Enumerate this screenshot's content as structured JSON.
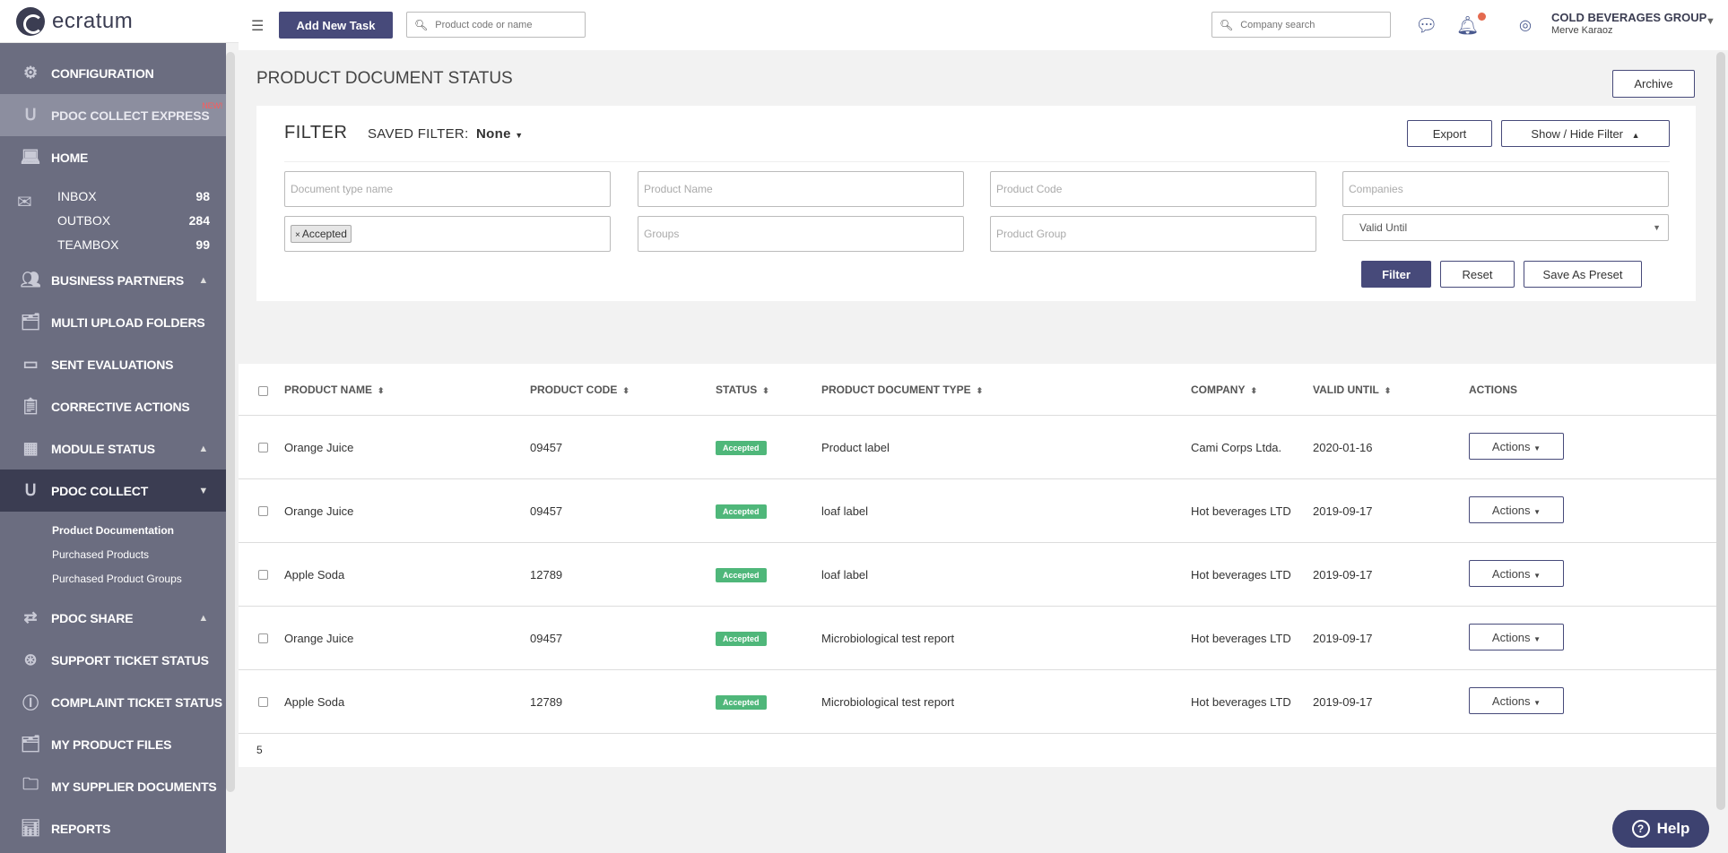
{
  "brand": {
    "logo_text": "ecratum"
  },
  "topbar": {
    "add_task_label": "Add New Task",
    "product_search_placeholder": "Product code or name",
    "company_search_placeholder": "Company search",
    "org_name": "COLD BEVERAGES GROUP",
    "user_name": "Merve Karaoz"
  },
  "sidebar": {
    "configuration": "CONFIGURATION",
    "pdoc_express": "PDOC COLLECT EXPRESS",
    "new_badge": "NEW!",
    "home": "HOME",
    "inbox": {
      "label": "INBOX",
      "count": "98"
    },
    "outbox": {
      "label": "OUTBOX",
      "count": "284"
    },
    "teambox": {
      "label": "TEAMBOX",
      "count": "99"
    },
    "business_partners": "BUSINESS PARTNERS",
    "multi_upload": "MULTI UPLOAD FOLDERS",
    "sent_evaluations": "SENT EVALUATIONS",
    "corrective_actions": "CORRECTIVE ACTIONS",
    "module_status": "MODULE STATUS",
    "pdoc_collect": "PDOC COLLECT",
    "sub_items": [
      "Product Documentation",
      "Purchased Products",
      "Purchased Product Groups"
    ],
    "pdoc_share": "PDOC SHARE",
    "support_ticket": "SUPPORT TICKET STATUS",
    "complaint_ticket": "COMPLAINT TICKET STATUS",
    "my_product_files": "MY PRODUCT FILES",
    "my_supplier_docs": "MY SUPPLIER DOCUMENTS",
    "reports": "REPORTS"
  },
  "page": {
    "title": "PRODUCT DOCUMENT STATUS",
    "archive_label": "Archive"
  },
  "filter": {
    "title": "FILTER",
    "saved_label": "SAVED FILTER:",
    "saved_value": "None",
    "export_label": "Export",
    "show_hide_label": "Show / Hide Filter",
    "doc_type_placeholder": "Document type name",
    "product_name_placeholder": "Product Name",
    "product_code_placeholder": "Product Code",
    "companies_placeholder": "Companies",
    "status_tag": "Accepted",
    "groups_placeholder": "Groups",
    "product_group_placeholder": "Product Group",
    "valid_until_value": "Valid Until",
    "filter_btn": "Filter",
    "reset_btn": "Reset",
    "save_preset_btn": "Save As Preset"
  },
  "table": {
    "headers": {
      "product_name": "PRODUCT NAME",
      "product_code": "PRODUCT CODE",
      "status": "STATUS",
      "doc_type": "PRODUCT DOCUMENT TYPE",
      "company": "COMPANY",
      "valid_until": "VALID UNTIL",
      "actions": "ACTIONS"
    },
    "rows": [
      {
        "product_name": "Orange Juice",
        "product_code": "09457",
        "status": "Accepted",
        "doc_type": "Product label",
        "company": "Cami Corps Ltda.",
        "valid_until": "2020-01-16",
        "actions": "Actions"
      },
      {
        "product_name": "Orange Juice",
        "product_code": "09457",
        "status": "Accepted",
        "doc_type": "loaf label",
        "company": "Hot beverages LTD",
        "valid_until": "2019-09-17",
        "actions": "Actions"
      },
      {
        "product_name": "Apple Soda",
        "product_code": "12789",
        "status": "Accepted",
        "doc_type": "loaf label",
        "company": "Hot beverages LTD",
        "valid_until": "2019-09-17",
        "actions": "Actions"
      },
      {
        "product_name": "Orange Juice",
        "product_code": "09457",
        "status": "Accepted",
        "doc_type": "Microbiological test report",
        "company": "Hot beverages LTD",
        "valid_until": "2019-09-17",
        "actions": "Actions"
      },
      {
        "product_name": "Apple Soda",
        "product_code": "12789",
        "status": "Accepted",
        "doc_type": "Microbiological test report",
        "company": "Hot beverages LTD",
        "valid_until": "2019-09-17",
        "actions": "Actions"
      }
    ],
    "count": "5"
  },
  "help": {
    "label": "Help"
  }
}
